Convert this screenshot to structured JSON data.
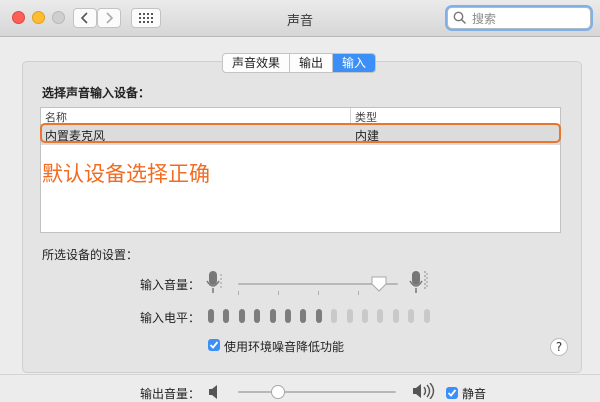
{
  "window": {
    "title": "声音"
  },
  "search": {
    "placeholder": "搜索"
  },
  "tabs": [
    {
      "label": "声音效果",
      "active": false
    },
    {
      "label": "输出",
      "active": false
    },
    {
      "label": "输入",
      "active": true
    }
  ],
  "input_panel": {
    "section_title": "选择声音输入设备：",
    "columns": {
      "name": "名称",
      "type": "类型"
    },
    "devices": [
      {
        "name": "内置麦克风",
        "type": "内建",
        "selected": true
      }
    ],
    "annotation": "默认设备选择正确",
    "settings_title": "所选设备的设置：",
    "input_volume_label": "输入音量：",
    "input_volume_value": 0.88,
    "input_level_label": "输入电平：",
    "input_level_active_bars": 8,
    "input_level_total_bars": 15,
    "noise_reduction": {
      "label": "使用环境噪音降低功能",
      "checked": true
    }
  },
  "output_section": {
    "volume_label": "输出音量：",
    "volume_value": 0.25,
    "mute": {
      "label": "静音",
      "checked": true
    }
  },
  "colors": {
    "accent": "#3b8ff6",
    "annotation": "#f36b21",
    "close": "#fd5f57",
    "minimize": "#febc2e"
  }
}
